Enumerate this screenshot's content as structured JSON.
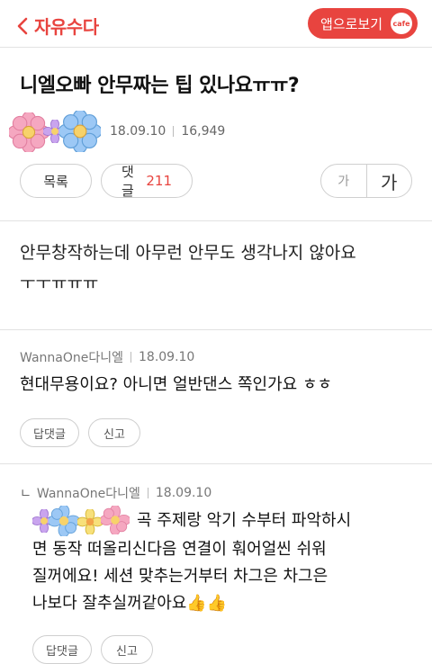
{
  "header": {
    "back_label": "자유수다",
    "app_button_label": "앱으로보기",
    "cafe_badge": "cafe"
  },
  "post": {
    "title": "니엘오빠 안무짜는 팁 있나요ㅠㅠ?",
    "date": "18.09.10",
    "views": "16,949",
    "list_button": "목록",
    "comment_button": "댓글",
    "comment_count": "211",
    "font_small": "가",
    "font_large": "가",
    "body_lines": [
      "안무창작하는데 아무런 안무도 생각나지 않아요",
      "ㅜㅜㅠㅠㅠ"
    ]
  },
  "comments": [
    {
      "author": "WannaOne다니엘",
      "date": "18.09.10",
      "text": "현대무용이요? 아니면 얼반댄스 쪽인가요 ㅎㅎ",
      "reply_button": "답댓글",
      "report_button": "신고"
    },
    {
      "reply_marker": "ㄴ",
      "author": "WannaOne다니엘",
      "date": "18.09.10",
      "lines": [
        "곡 주제랑 악기 수부터 파악하시",
        "면 동작 떠올리신다음 연결이 훠어얼씬 쉬워",
        "질꺼에요! 세션 맞추는거부터 차그은 차그은",
        "나보다 잘추실꺼같아요👍👍"
      ],
      "reply_button": "답댓글",
      "report_button": "신고"
    }
  ],
  "colors": {
    "accent": "#e8443f"
  },
  "icons": {
    "back": "chevron-left-icon",
    "flowers": "flower-emoticon-icon",
    "thumbs_up": "thumbs-up-icon"
  }
}
